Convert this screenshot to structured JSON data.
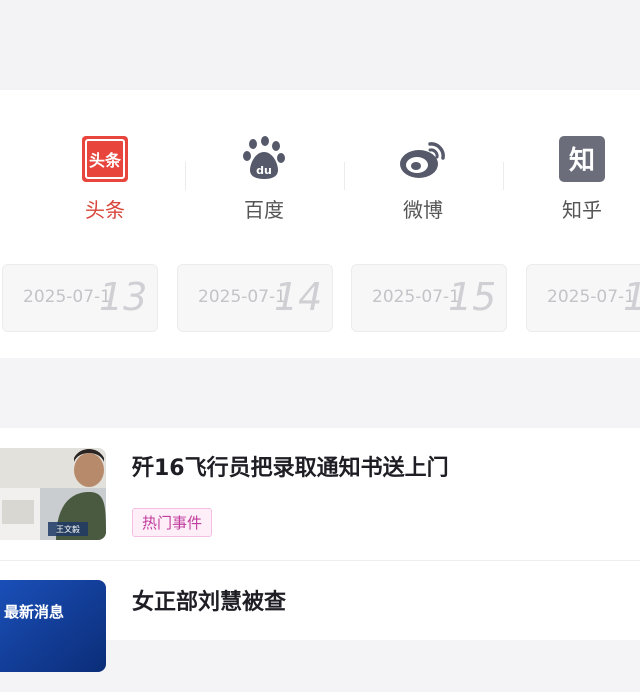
{
  "platforms": [
    {
      "label": "头条",
      "icon": "toutiao-icon",
      "icon_text": "头条",
      "active": true
    },
    {
      "label": "百度",
      "icon": "baidu-paw-icon",
      "icon_text": "du",
      "active": false
    },
    {
      "label": "微博",
      "icon": "weibo-icon",
      "active": false
    },
    {
      "label": "知乎",
      "icon": "zhihu-icon",
      "icon_text": "知",
      "active": false
    }
  ],
  "dates": [
    {
      "date": "2025-07-1",
      "day": "13"
    },
    {
      "date": "2025-07-1",
      "day": "14"
    },
    {
      "date": "2025-07-1",
      "day": "15"
    },
    {
      "date": "2025-07-1",
      "day": "1"
    }
  ],
  "news": [
    {
      "title": "歼16飞行员把录取通知书送上门",
      "tag": "热门事件",
      "thumb_caption": "王文毅"
    },
    {
      "title": "女正部刘慧被查",
      "thumb_caption": "最新消息"
    }
  ],
  "colors": {
    "accent": "#d8453a",
    "tag_text": "#c13d9d",
    "tag_bg": "#fdeef8"
  }
}
